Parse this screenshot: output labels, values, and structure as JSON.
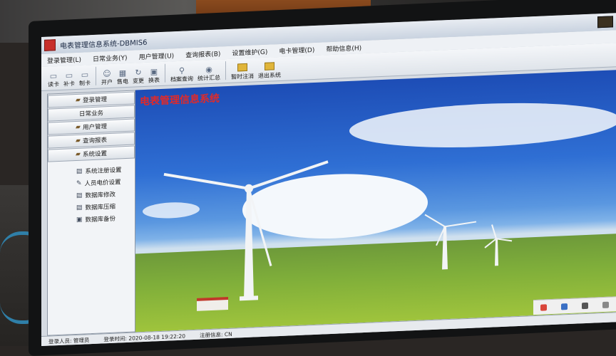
{
  "window": {
    "title": "电表管理信息系统-DBMIS6"
  },
  "menu": {
    "items": [
      {
        "label": "登录管理(L)"
      },
      {
        "label": "日常业务(Y)"
      },
      {
        "label": "用户管理(U)"
      },
      {
        "label": "查询报表(B)"
      },
      {
        "label": "设置维护(G)"
      },
      {
        "label": "电卡管理(D)"
      },
      {
        "label": "帮助信息(H)"
      }
    ]
  },
  "toolbar": {
    "tools": [
      {
        "label": "读卡",
        "icon": "card-read-icon"
      },
      {
        "label": "补卡",
        "icon": "card-reissue-icon"
      },
      {
        "label": "制卡",
        "icon": "card-make-icon"
      },
      {
        "label": "开户",
        "icon": "open-account-icon"
      },
      {
        "label": "售电",
        "icon": "sell-power-icon"
      },
      {
        "label": "变更",
        "icon": "change-icon"
      },
      {
        "label": "换表",
        "icon": "replace-meter-icon"
      },
      {
        "label": "档案查询",
        "icon": "archive-query-icon"
      },
      {
        "label": "统计汇总",
        "icon": "statistics-icon"
      },
      {
        "label": "暂时注消",
        "icon": "temp-logout-icon"
      },
      {
        "label": "退出系统",
        "icon": "exit-icon"
      }
    ]
  },
  "sidebar": {
    "buttons": [
      {
        "label": "登录管理"
      },
      {
        "label": "日常业务"
      },
      {
        "label": "用户管理"
      },
      {
        "label": "查询报表"
      },
      {
        "label": "系统设置"
      }
    ],
    "sub_items": [
      {
        "label": "系统注册设置",
        "icon": "register-settings-icon"
      },
      {
        "label": "人员电价设置",
        "icon": "price-settings-icon"
      },
      {
        "label": "数据库修改",
        "icon": "db-edit-icon"
      },
      {
        "label": "数据库压缩",
        "icon": "db-compress-icon"
      },
      {
        "label": "数据库备份",
        "icon": "db-backup-icon"
      }
    ]
  },
  "main": {
    "title": "电表管理信息系统"
  },
  "status": {
    "user": "登录人员: 管理员",
    "time": "登录时间: 2020-08-18 19:22:20",
    "reg": "注册信息: CN"
  },
  "colors": {
    "title_red": "#e02a2a",
    "sky_blue": "#2f6fd4",
    "grass_green": "#7fae3a"
  }
}
